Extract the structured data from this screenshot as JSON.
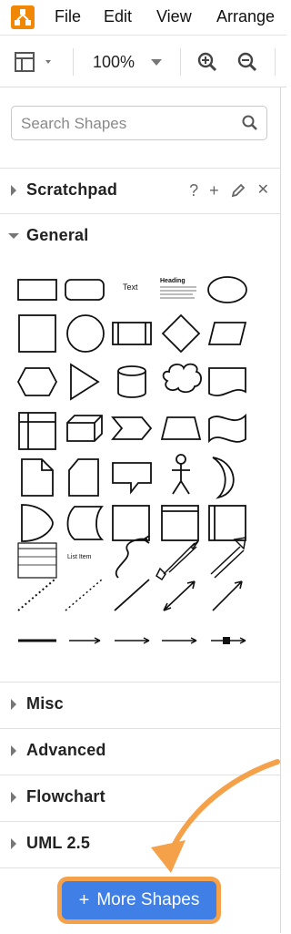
{
  "menubar": {
    "items": [
      "File",
      "Edit",
      "View",
      "Arrange"
    ]
  },
  "toolbar": {
    "zoom": "100%"
  },
  "search": {
    "placeholder": "Search Shapes"
  },
  "sections": {
    "scratchpad": "Scratchpad",
    "general": "General",
    "misc": "Misc",
    "advanced": "Advanced",
    "flowchart": "Flowchart",
    "uml": "UML 2.5"
  },
  "scratchpad_actions": {
    "help": "?",
    "add": "+",
    "close": "✕"
  },
  "shape_labels": {
    "text": "Text",
    "heading": "Heading",
    "list_item": "List Item"
  },
  "more_shapes": {
    "label": "More Shapes",
    "plus": "+"
  },
  "colors": {
    "accent": "#3f7fe6",
    "annotation": "#f4a14a",
    "logo": "#f08705"
  }
}
